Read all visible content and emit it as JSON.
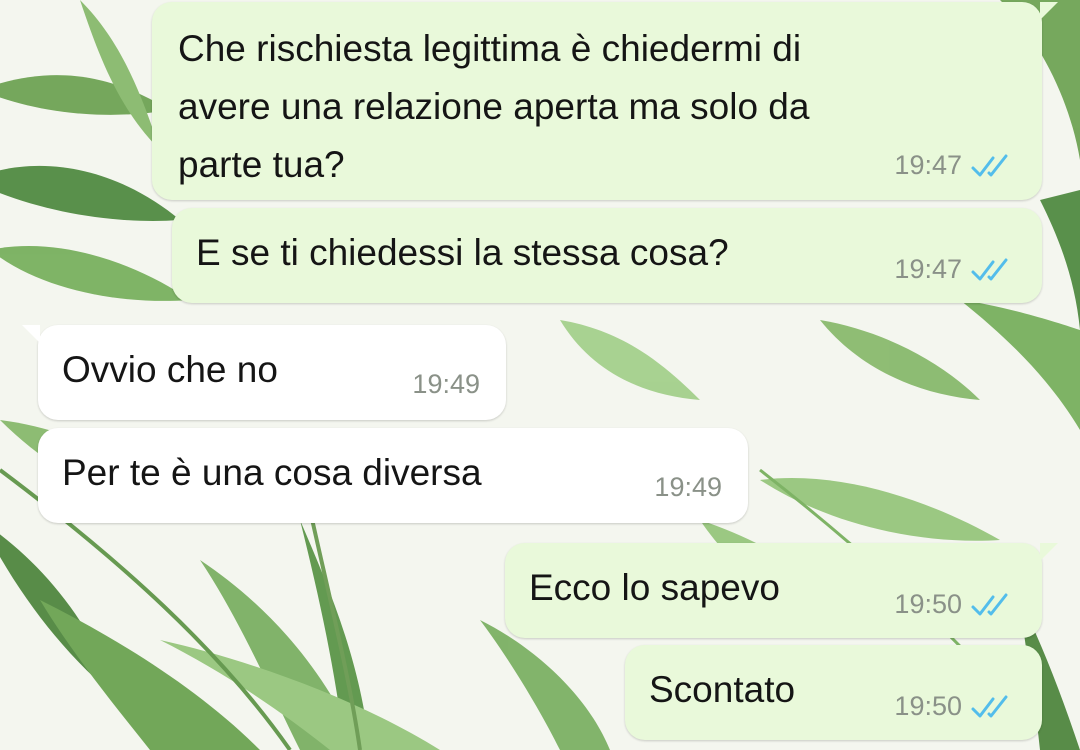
{
  "theme": {
    "outgoing_bubble": "#e9f9da",
    "incoming_bubble": "#ffffff",
    "read_tick": "#53bdeb",
    "time_color": "#8a9188",
    "wallpaper_leaf": "#4f8f3a"
  },
  "wallpaper": {
    "icon": "palm-leaves-wallpaper"
  },
  "messages": [
    {
      "direction": "outgoing",
      "lines": [
        "Che rischiesta legittima è chiedermi di",
        "avere una relazione aperta ma solo da",
        "parte tua?"
      ],
      "time": "19:47",
      "status": "read-double-tick-icon"
    },
    {
      "direction": "outgoing",
      "lines": [
        "E se ti chiedessi la stessa cosa?"
      ],
      "time": "19:47",
      "status": "read-double-tick-icon"
    },
    {
      "direction": "incoming",
      "lines": [
        "Ovvio che no"
      ],
      "time": "19:49"
    },
    {
      "direction": "incoming",
      "lines": [
        "Per te è una cosa diversa"
      ],
      "time": "19:49"
    },
    {
      "direction": "outgoing",
      "lines": [
        "Ecco lo sapevo"
      ],
      "time": "19:50",
      "status": "read-double-tick-icon"
    },
    {
      "direction": "outgoing",
      "lines": [
        "Scontato"
      ],
      "time": "19:50",
      "status": "read-double-tick-icon"
    }
  ]
}
